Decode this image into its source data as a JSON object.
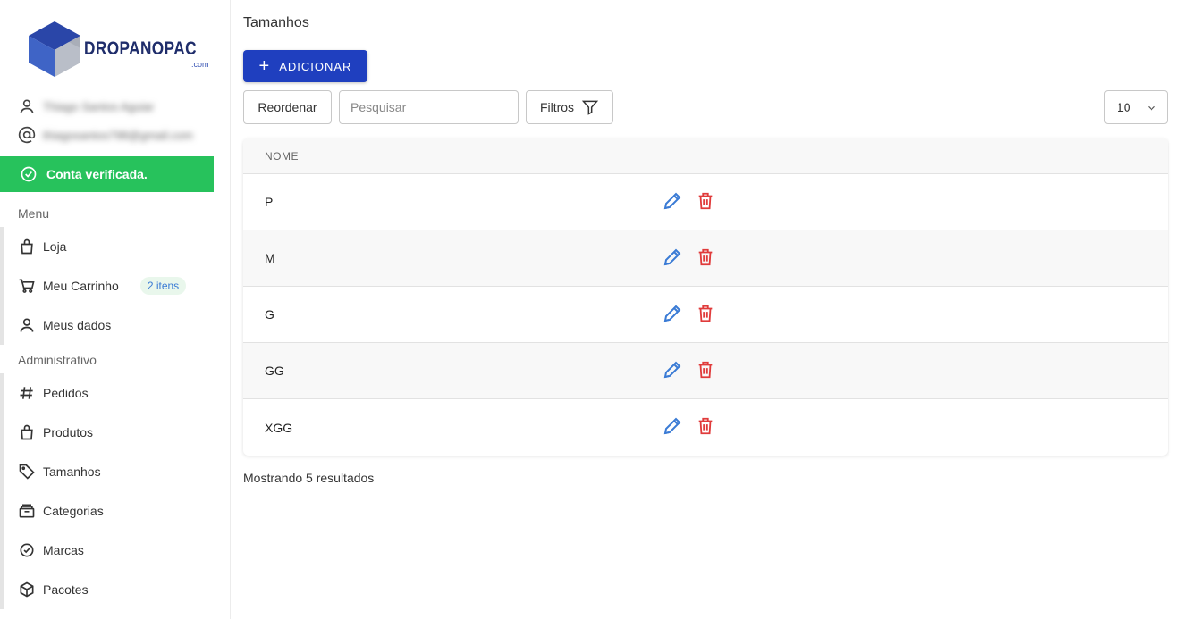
{
  "brand": {
    "name": "DROPANOPAC",
    "sub": ".com"
  },
  "user": {
    "name": "Thiago Santos Aguiar",
    "email": "thiagosantos798@gmail.com"
  },
  "verified_label": "Conta verificada.",
  "sidebar": {
    "menu_title": "Menu",
    "menu_items": [
      {
        "label": "Loja",
        "icon": "bag-icon"
      },
      {
        "label": "Meu Carrinho",
        "icon": "cart-icon",
        "badge": "2 itens"
      },
      {
        "label": "Meus dados",
        "icon": "user-icon"
      }
    ],
    "admin_title": "Administrativo",
    "admin_items": [
      {
        "label": "Pedidos",
        "icon": "hash-icon"
      },
      {
        "label": "Produtos",
        "icon": "bag-icon"
      },
      {
        "label": "Tamanhos",
        "icon": "tag-icon"
      },
      {
        "label": "Categorias",
        "icon": "archive-icon"
      },
      {
        "label": "Marcas",
        "icon": "check-circle-icon"
      },
      {
        "label": "Pacotes",
        "icon": "box-icon"
      }
    ]
  },
  "main": {
    "title": "Tamanhos",
    "add_label": "ADICIONAR",
    "reorder_label": "Reordenar",
    "search_placeholder": "Pesquisar",
    "filters_label": "Filtros",
    "page_size": "10",
    "table": {
      "column": "NOME",
      "rows": [
        "P",
        "M",
        "G",
        "GG",
        "XGG"
      ]
    },
    "results_text": "Mostrando 5 resultados"
  },
  "colors": {
    "primary": "#1f3fbf",
    "success": "#27c25c",
    "edit": "#3a7bd5",
    "delete": "#e03b3b"
  }
}
